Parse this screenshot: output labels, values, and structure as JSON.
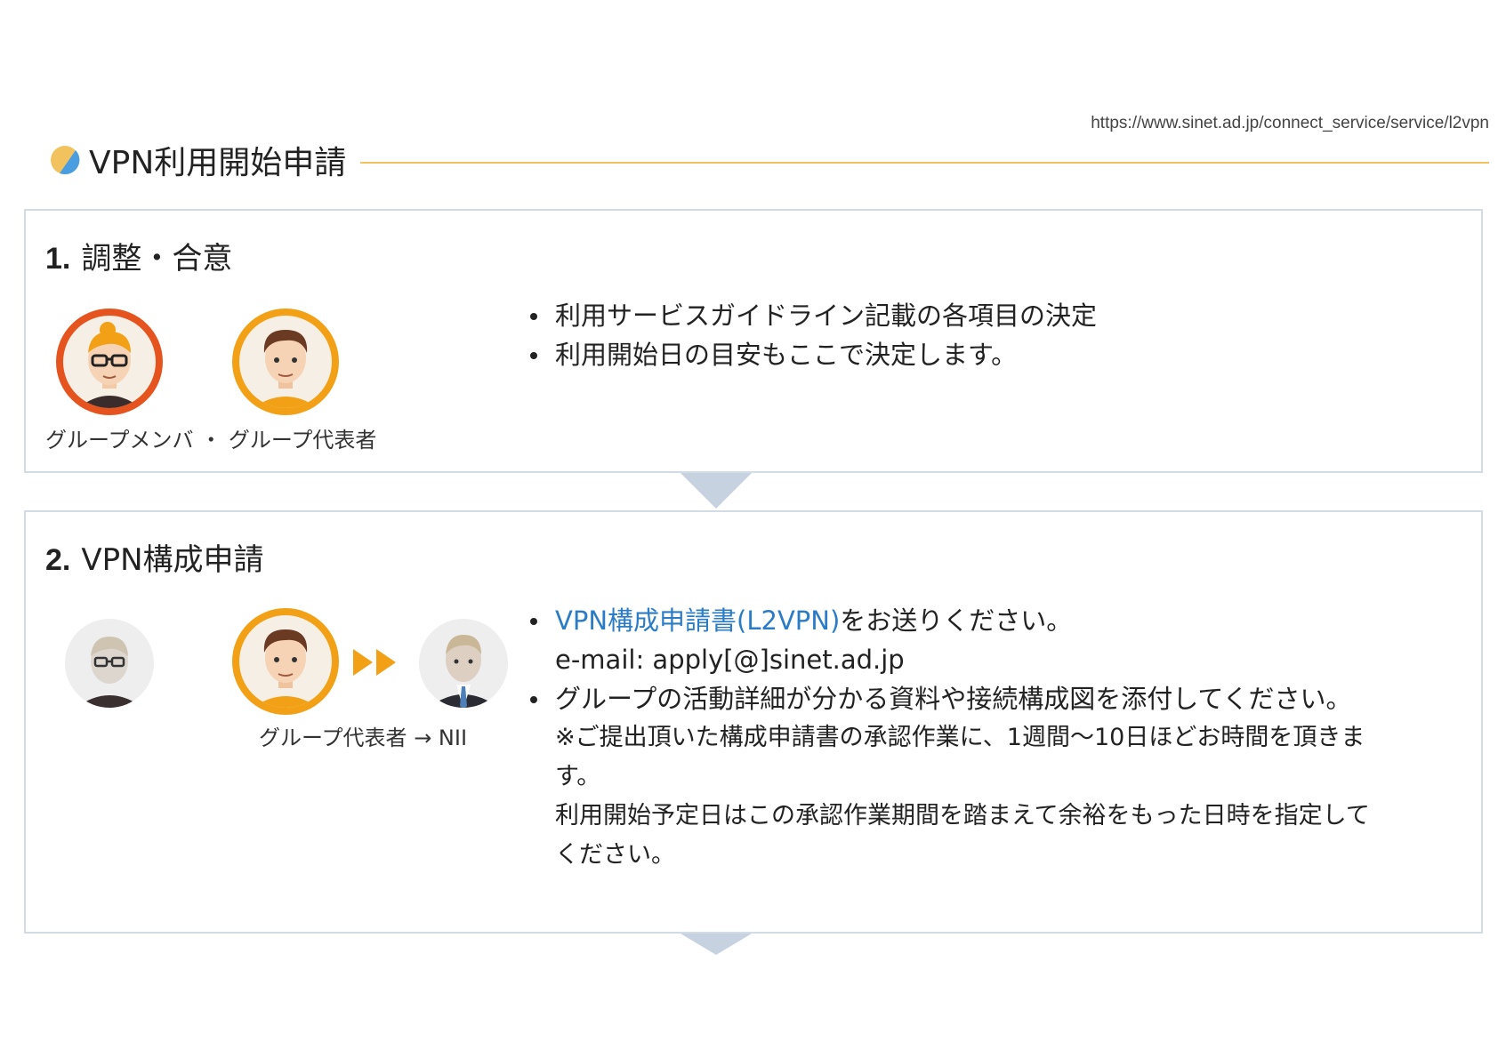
{
  "url": "https://www.sinet.ad.jp/connect_service/service/l2vpn",
  "page_title": "VPN利用開始申請",
  "colors": {
    "accent_line": "#f2c25e",
    "border": "#d3dbe4",
    "arrow": "#c6d2e0",
    "link": "#2a7cc7",
    "member_ring": "#e5541e",
    "rep_ring": "#f2a016"
  },
  "step1": {
    "number": "1.",
    "title": "調整・合意",
    "caption": "グループメンバ ・ グループ代表者",
    "bullets": [
      "利用サービスガイドライン記載の各項目の決定",
      "利用開始日の目安もここで決定します。"
    ]
  },
  "step2": {
    "number": "2.",
    "title": "VPN構成申請",
    "caption": "グループ代表者 → NII",
    "bullet1_link": "VPN構成申請書(L2VPN)",
    "bullet1_rest": "をお送りください。",
    "email": "e-mail: apply[@]sinet.ad.jp",
    "bullet2": "グループの活動詳細が分かる資料や接続構成図を添付してください。",
    "note1": "※ご提出頂いた構成申請書の承認作業に、1週間〜10日ほどお時間を頂きま",
    "note2": "す。",
    "note3": "利用開始予定日はこの承認作業期間を踏まえて余裕をもった日時を指定して",
    "note4": "ください。"
  }
}
